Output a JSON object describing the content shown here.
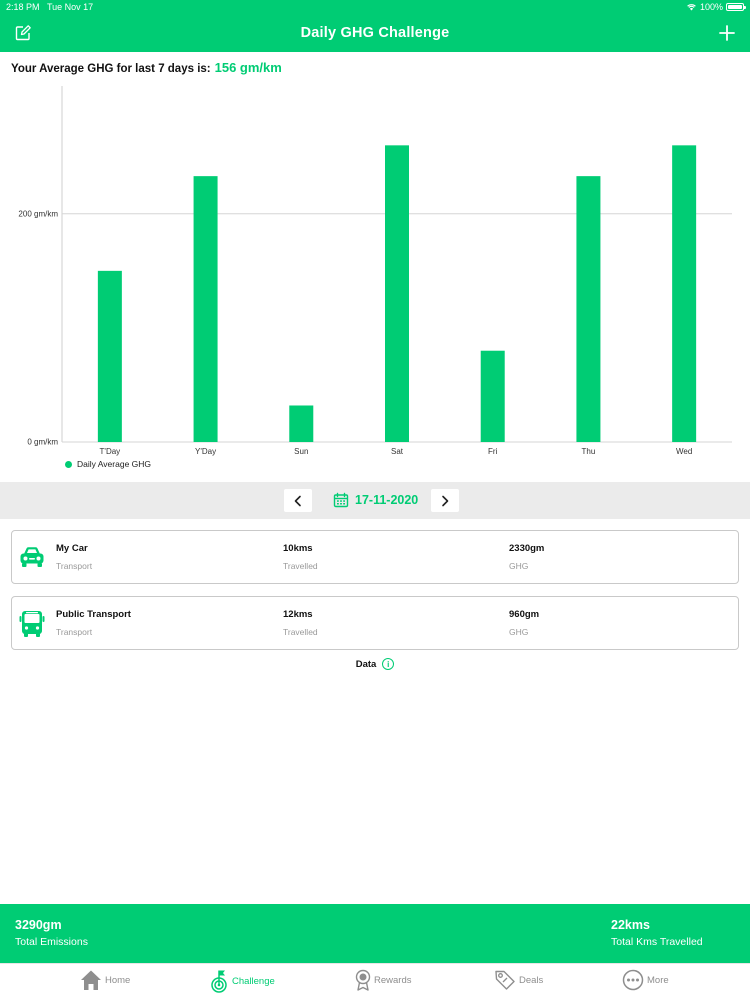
{
  "status_bar": {
    "time": "2:18 PM",
    "date": "Tue Nov 17",
    "battery": "100%"
  },
  "header": {
    "title": "Daily GHG Challenge",
    "edit_icon": "edit-icon",
    "add_icon": "plus-icon"
  },
  "average": {
    "label": "Your Average GHG for last 7 days is:",
    "value": "156 gm/km"
  },
  "chart_data": {
    "type": "bar",
    "categories": [
      "T'Day",
      "Y'Day",
      "Sun",
      "Sat",
      "Fri",
      "Thu",
      "Wed"
    ],
    "series": [
      {
        "name": "Daily Average GHG",
        "values": [
          150,
          233,
          32,
          260,
          80,
          233,
          260
        ]
      }
    ],
    "y_ticks": [
      {
        "value": 0,
        "label": "0 gm/km"
      },
      {
        "value": 200,
        "label": "200 gm/km"
      }
    ],
    "ylim": [
      0,
      312
    ],
    "color": "#00cc74",
    "legend_position": "bottom-left",
    "grid": true
  },
  "legend": {
    "label": "Daily Average GHG"
  },
  "date_nav": {
    "date": "17-11-2020",
    "prev_icon": "chevron-left-icon",
    "next_icon": "chevron-right-icon",
    "calendar_icon": "calendar-icon"
  },
  "trips": [
    {
      "name": "My Car",
      "type": "Transport",
      "distance": "10kms",
      "distance_label": "Travelled",
      "ghg": "2330gm",
      "ghg_label": "GHG",
      "icon": "car-icon"
    },
    {
      "name": "Public Transport",
      "type": "Transport",
      "distance": "12kms",
      "distance_label": "Travelled",
      "ghg": "960gm",
      "ghg_label": "GHG",
      "icon": "bus-icon"
    }
  ],
  "data_info": {
    "label": "Data",
    "icon": "info-icon"
  },
  "summary": {
    "emissions_value": "3290gm",
    "emissions_label": "Total Emissions",
    "kms_value": "22kms",
    "kms_label": "Total Kms Travelled"
  },
  "tabs": [
    {
      "label": "Home",
      "icon": "home-icon",
      "active": false
    },
    {
      "label": "Challenge",
      "icon": "challenge-icon",
      "active": true
    },
    {
      "label": "Rewards",
      "icon": "rewards-icon",
      "active": false
    },
    {
      "label": "Deals",
      "icon": "tag-icon",
      "active": false
    },
    {
      "label": "More",
      "icon": "more-icon",
      "active": false
    }
  ],
  "colors": {
    "accent": "#00cc74",
    "date_bar_bg": "#ebebeb",
    "muted_text": "#999999"
  }
}
